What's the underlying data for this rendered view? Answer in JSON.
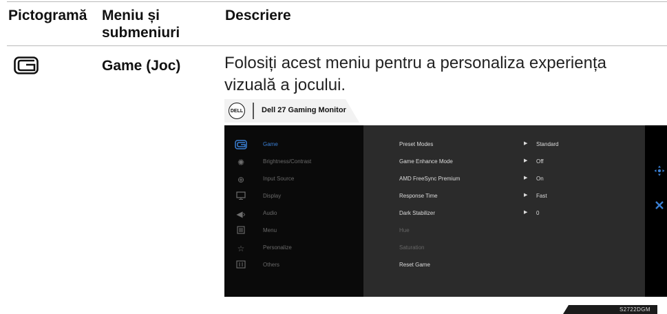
{
  "table": {
    "headers": [
      "Pictogramă",
      "Meniu și submeniuri",
      "Descriere"
    ],
    "row": {
      "menu_name": "Game (Joc)",
      "description": "Folosiți acest meniu pentru a personaliza experiența vizuală a jocului."
    }
  },
  "osd": {
    "brand_logo_text": "DELL",
    "title": "Dell 27 Gaming Monitor",
    "menu_items": [
      {
        "label": "Game",
        "icon": "game-icon",
        "active": true
      },
      {
        "label": "Brightness/Contrast",
        "icon": "brightness-icon",
        "active": false
      },
      {
        "label": "Input Source",
        "icon": "input-source-icon",
        "active": false
      },
      {
        "label": "Display",
        "icon": "display-icon",
        "active": false
      },
      {
        "label": "Audio",
        "icon": "audio-icon",
        "active": false
      },
      {
        "label": "Menu",
        "icon": "menu-icon",
        "active": false
      },
      {
        "label": "Personalize",
        "icon": "star-icon",
        "active": false
      },
      {
        "label": "Others",
        "icon": "others-icon",
        "active": false
      }
    ],
    "submenu": [
      {
        "label": "Preset Modes",
        "value": "Standard",
        "arrow": true,
        "dim": false
      },
      {
        "label": "Game Enhance Mode",
        "value": "Off",
        "arrow": true,
        "dim": false
      },
      {
        "label": "AMD FreeSync Premium",
        "value": "On",
        "arrow": true,
        "dim": false
      },
      {
        "label": "Response Time",
        "value": "Fast",
        "arrow": true,
        "dim": false
      },
      {
        "label": "Dark Stabilizer",
        "value": "0",
        "arrow": true,
        "dim": false
      },
      {
        "label": "Hue",
        "value": "",
        "arrow": false,
        "dim": true
      },
      {
        "label": "Saturation",
        "value": "",
        "arrow": false,
        "dim": true
      },
      {
        "label": "Reset Game",
        "value": "",
        "arrow": false,
        "dim": false
      }
    ],
    "nav_icons": [
      "joystick-icon",
      "close-icon"
    ],
    "accent_color": "#3a7fd4"
  },
  "model": "S2722DGM"
}
